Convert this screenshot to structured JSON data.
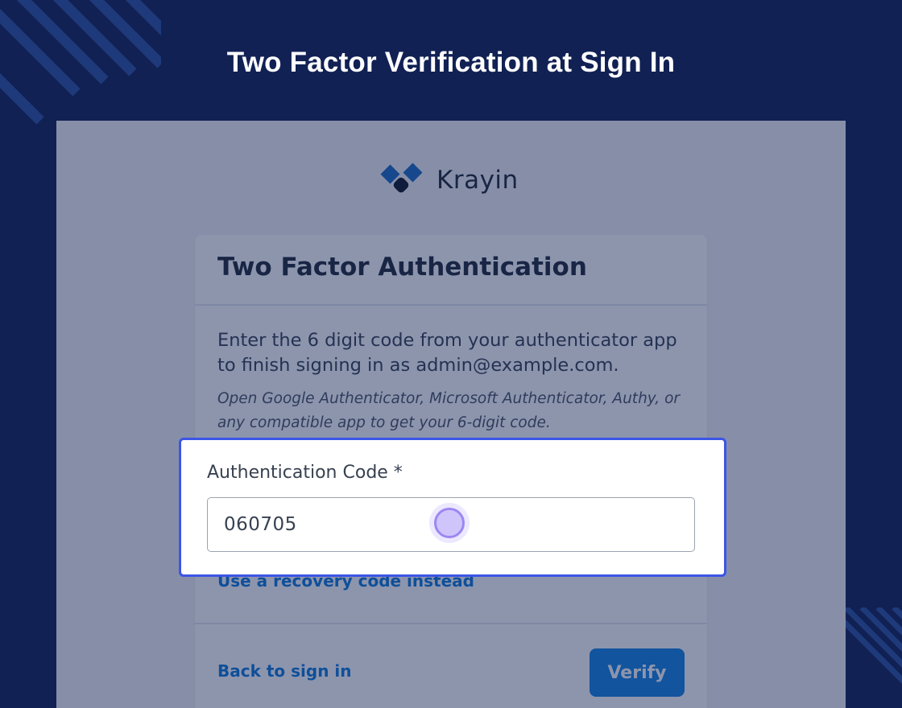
{
  "banner": {
    "title": "Two Factor Verification at Sign In"
  },
  "logo": {
    "name": "Krayin",
    "icon": "krayin-logo-icon"
  },
  "card": {
    "title": "Two Factor Authentication",
    "description": "Enter the 6 digit code from your authenticator app to finish signing in as admin@example.com.",
    "hint": "Open Google Authenticator, Microsoft Authenticator, Authy, or any compatible app to get your 6-digit code.",
    "field_label": "Authentication Code *",
    "code_value": "060705",
    "recovery_link": "Use a recovery code instead",
    "back_link": "Back to sign in",
    "verify_label": "Verify"
  },
  "colors": {
    "banner_bg": "#112154",
    "accent_link": "#0f7ad8",
    "button_bg": "#1583e2",
    "highlight_border": "#3b55e6"
  }
}
